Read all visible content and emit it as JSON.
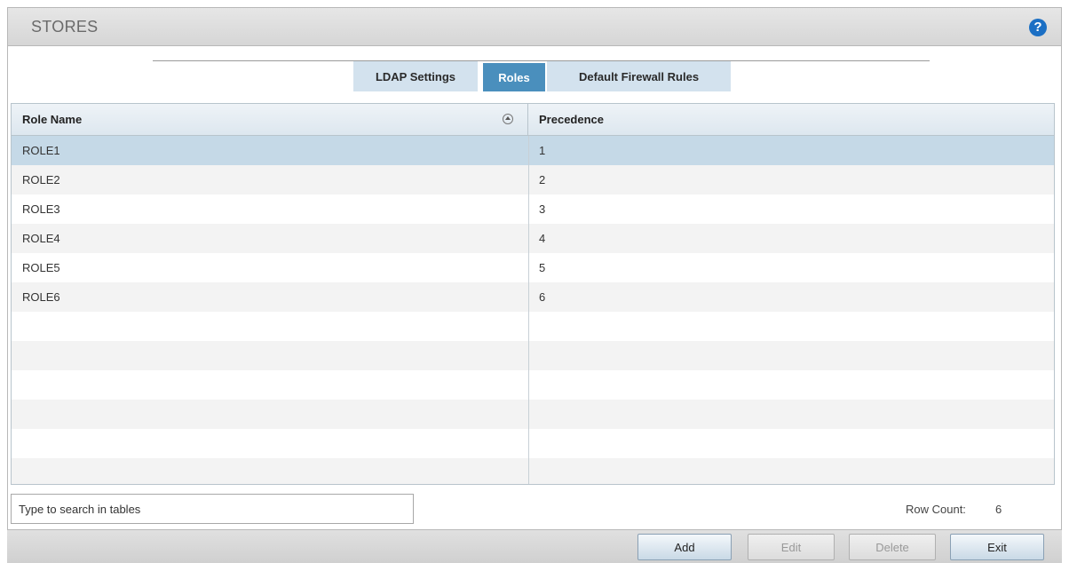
{
  "header": {
    "title": "STORES",
    "help_icon": "?"
  },
  "tabs": [
    {
      "label": "LDAP Settings",
      "active": false
    },
    {
      "label": "Roles",
      "active": true
    },
    {
      "label": "Default Firewall Rules",
      "active": false
    }
  ],
  "table": {
    "columns": [
      "Role Name",
      "Precedence"
    ],
    "sort_icon": "sort-ascending-icon",
    "rows": [
      {
        "name": "ROLE1",
        "precedence": "1",
        "selected": true
      },
      {
        "name": "ROLE2",
        "precedence": "2"
      },
      {
        "name": "ROLE3",
        "precedence": "3"
      },
      {
        "name": "ROLE4",
        "precedence": "4"
      },
      {
        "name": "ROLE5",
        "precedence": "5"
      },
      {
        "name": "ROLE6",
        "precedence": "6"
      }
    ],
    "empty_rows": 6
  },
  "search": {
    "placeholder": "Type to search in tables"
  },
  "row_count": {
    "label": "Row Count:",
    "value": "6"
  },
  "buttons": {
    "add": "Add",
    "edit": "Edit",
    "delete": "Delete",
    "exit": "Exit"
  },
  "colors": {
    "active_tab": "#4a8fbd",
    "selected_row": "#c5d9e7",
    "help_icon": "#1b6fc4"
  }
}
